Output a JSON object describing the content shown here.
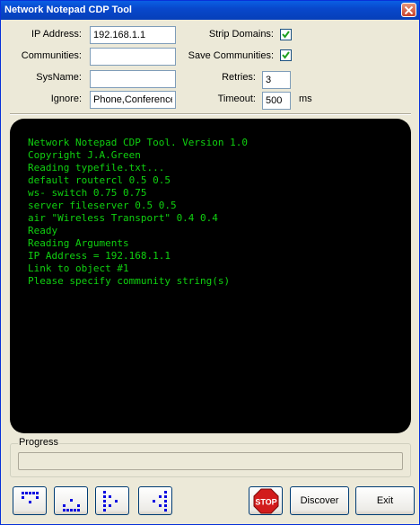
{
  "window": {
    "title": "Network Notepad CDP Tool"
  },
  "form": {
    "ip_label": "IP Address:",
    "ip_value": "192.168.1.1",
    "communities_label": "Communities:",
    "communities_value": "",
    "sysname_label": "SysName:",
    "sysname_value": "",
    "ignore_label": "Ignore:",
    "ignore_value": "Phone,Conference",
    "strip_domains_label": "Strip Domains:",
    "strip_domains_checked": true,
    "save_communities_label": "Save Communities:",
    "save_communities_checked": true,
    "retries_label": "Retries:",
    "retries_value": "3",
    "timeout_label": "Timeout:",
    "timeout_value": "500",
    "timeout_unit": "ms"
  },
  "console": {
    "text_color": "#10d010",
    "lines": [
      "Network Notepad CDP Tool. Version 1.0",
      "Copyright J.A.Green",
      "Reading typefile.txt...",
      "default routercl 0.5 0.5",
      "ws- switch 0.75 0.75",
      "server fileserver 0.5 0.5",
      "air \"Wireless Transport\" 0.4 0.4",
      "Ready",
      "Reading Arguments",
      "IP Address = 192.168.1.1",
      "Link to object #1",
      "Please specify community string(s)"
    ]
  },
  "progress": {
    "label": "Progress",
    "value": 0
  },
  "toolbar": {
    "layout_buttons": [
      "layout-top-icon",
      "layout-bottom-icon",
      "layout-left-icon",
      "layout-right-icon"
    ],
    "stop_label": "STOP",
    "discover_label": "Discover",
    "exit_label": "Exit"
  }
}
